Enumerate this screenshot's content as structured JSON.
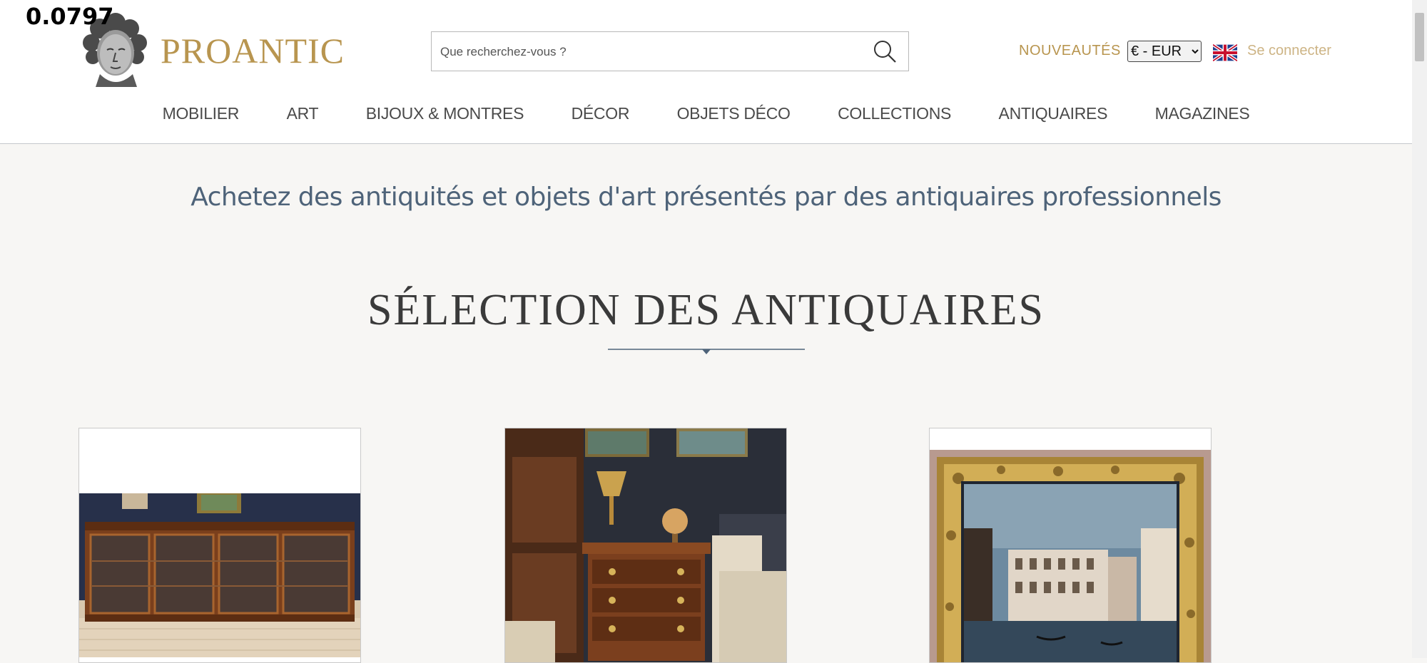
{
  "debug_value": "0.0797",
  "brand": {
    "name": "PROANTIC"
  },
  "search": {
    "placeholder": "Que recherchez-vous ?"
  },
  "header": {
    "nouveautes_label": "NOUVEAUTÉS",
    "currency_selected": "€ - EUR",
    "login_label": "Se connecter"
  },
  "nav": {
    "items": [
      "MOBILIER",
      "ART",
      "BIJOUX & MONTRES",
      "DÉCOR",
      "OBJETS DÉCO",
      "COLLECTIONS",
      "ANTIQUAIRES",
      "MAGAZINES"
    ]
  },
  "main": {
    "tagline": "Achetez des antiquités et objets d'art présentés par des antiquaires professionnels",
    "section_title": "SÉLECTION DES ANTIQUAIRES"
  },
  "colors": {
    "gold": "#b8954f",
    "nav_text": "#4a4a4a",
    "tagline_blue": "#4e6379",
    "page_bg": "#f7f6f4"
  }
}
